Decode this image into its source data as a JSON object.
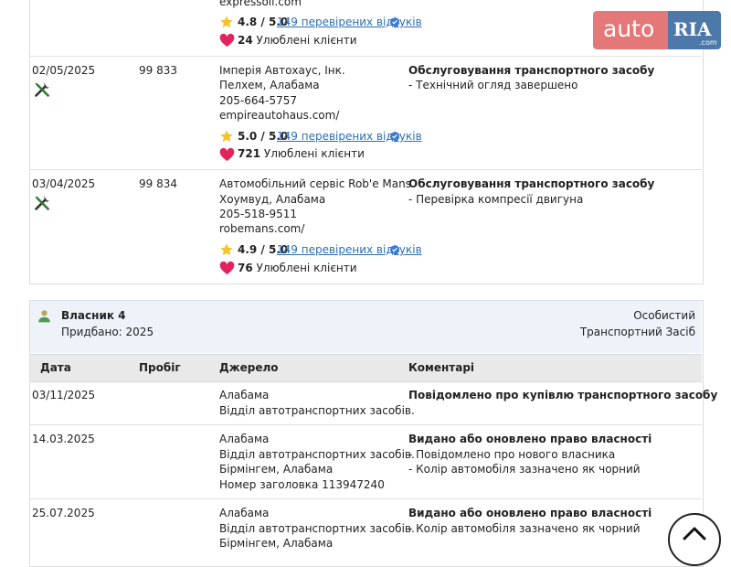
{
  "services": [
    {
      "website": "expressoil.com",
      "rating": "4.8 / 5.0",
      "reviews_link": "149 перевірених відгуків",
      "favorites_count": "24",
      "favorites_label": "Улюблені клієнти"
    },
    {
      "date": "02/05/2025",
      "mileage": "99 833",
      "name": "Імперія Автохаус, Інк.",
      "location": "Пелхем, Алабама",
      "phone": "205-664-5757",
      "website": "empireautohaus.com/",
      "rating": "5.0 / 5.0",
      "reviews_link": "149 перевірених відгуків",
      "favorites_count": "721",
      "favorites_label": "Улюблені клієнти",
      "comment_title": "Обслуговування транспортного засобу",
      "comment_item": "- Технічний огляд завершено"
    },
    {
      "date": "03/04/2025",
      "mileage": "99 834",
      "name": "Автомобільний сервіс Rob'e Mans",
      "location": "Хоумвуд, Алабама",
      "phone": "205-518-9511",
      "website": "robemans.com/",
      "rating": "4.9 / 5.0",
      "reviews_link": "149 перевірених відгуків",
      "favorites_count": "76",
      "favorites_label": "Улюблені клієнти",
      "comment_title": "Обслуговування транспортного засобу",
      "comment_item": "- Перевірка компресії двигуна"
    }
  ],
  "owner": {
    "title": "Власник 4",
    "purchased": "Придбано: 2025",
    "type": "Особистий",
    "category": "Транспортний Засіб"
  },
  "table": {
    "headers": [
      "Дата",
      "Пробіг",
      "Джерело",
      "Коментарі"
    ],
    "rows": [
      {
        "date": "03/11/2025",
        "source": [
          "Алабама",
          "Відділ автотранспортних засобів."
        ],
        "comment_title": "Повідомлено про купівлю транспортного засобу",
        "comment_items": []
      },
      {
        "date": "14.03.2025",
        "source": [
          "Алабама",
          "Відділ автотранспортних засобів.",
          "Бірмінгем, Алабама",
          "Номер заголовка 113947240"
        ],
        "comment_title": "Видано або оновлено право власності",
        "comment_items": [
          "- Повідомлено про нового власника",
          "- Колір автомобіля зазначено як чорний"
        ]
      },
      {
        "date": "25.07.2025",
        "source": [
          "Алабама",
          "Відділ автотранспортних засобів.",
          "Бірмінгем, Алабама"
        ],
        "comment_title": "Видано або оновлено право власності",
        "comment_items": [
          "- Колір автомобіля зазначено як чорний"
        ]
      }
    ]
  },
  "logo": {
    "auto": "auto",
    "ria": "RIA",
    "domain": ".com"
  },
  "colors": {
    "link": "#2b6fb3",
    "star": "#f4c22b",
    "heart": "#e0245e",
    "verified": "#3a7bd5",
    "owner_header_bg": "#eef3fa",
    "table_header_bg": "#e9e9e9",
    "logo_red": "#e26e6e",
    "logo_blue": "#3e6ea3"
  },
  "icons": [
    "wrench-screwdriver-icon",
    "star-icon",
    "heart-icon",
    "verified-icon",
    "person-icon",
    "chevron-up-icon"
  ]
}
